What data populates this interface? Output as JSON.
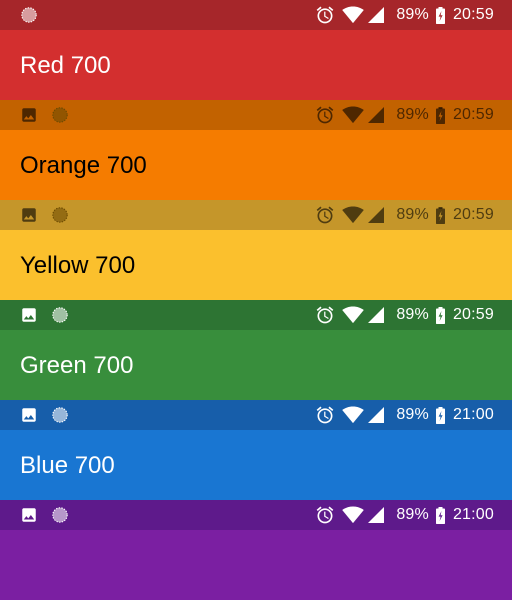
{
  "blocks": [
    {
      "name": "red",
      "status_color": "#A6262A",
      "bar_color": "#D32F2F",
      "title": "Red 700",
      "battery_pct": "89%",
      "time": "20:59",
      "fg": "light",
      "left_icons": [
        "dotted-circle-icon"
      ]
    },
    {
      "name": "orange",
      "status_color": "#C26200",
      "bar_color": "#F57C00",
      "title": "Orange 700",
      "battery_pct": "89%",
      "time": "20:59",
      "fg": "dark",
      "left_icons": [
        "gallery-icon",
        "dotted-circle-icon"
      ]
    },
    {
      "name": "yellow",
      "status_color": "#C5962A",
      "bar_color": "#FBC02D",
      "title": "Yellow 700",
      "battery_pct": "89%",
      "time": "20:59",
      "fg": "dark",
      "left_icons": [
        "gallery-icon",
        "dotted-circle-icon"
      ]
    },
    {
      "name": "green",
      "status_color": "#2D7433",
      "bar_color": "#388E3C",
      "title": "Green 700",
      "battery_pct": "89%",
      "time": "20:59",
      "fg": "light",
      "left_icons": [
        "gallery-icon",
        "dotted-circle-icon"
      ]
    },
    {
      "name": "blue",
      "status_color": "#175EAA",
      "bar_color": "#1976D2",
      "title": "Blue 700",
      "battery_pct": "89%",
      "time": "21:00",
      "fg": "light",
      "left_icons": [
        "gallery-icon",
        "dotted-circle-icon"
      ]
    },
    {
      "name": "purple",
      "status_color": "#5E1A8B",
      "bar_color": "#7B1FA2",
      "title": "",
      "battery_pct": "89%",
      "time": "21:00",
      "fg": "light",
      "left_icons": [
        "gallery-icon",
        "dotted-circle-icon"
      ]
    }
  ]
}
